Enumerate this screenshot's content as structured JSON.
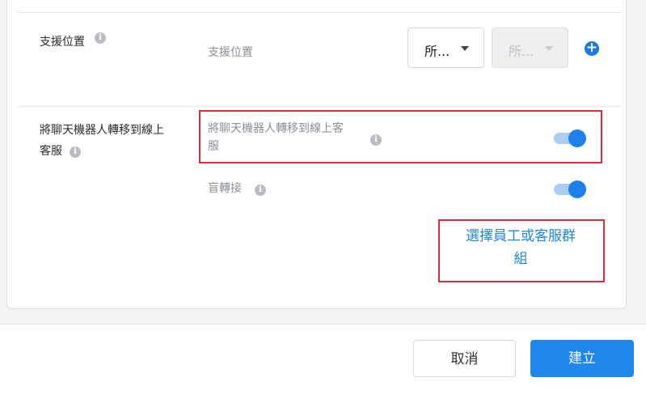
{
  "support_location": {
    "row_label": "支援位置",
    "field_label": "支援位置",
    "select_primary": "所...",
    "select_secondary": "所..."
  },
  "transfer": {
    "row_label_line1": "將聊天機器人轉移到線上",
    "row_label_line2": "客服",
    "field_label_line1": "將聊天機器人轉移到線上客",
    "field_label_line2": "服",
    "toggle_on": true
  },
  "blind_transfer": {
    "label": "盲轉接",
    "toggle_on": true
  },
  "select_agent": {
    "line1": "選擇員工或客服群",
    "line2": "組"
  },
  "footer": {
    "cancel": "取消",
    "create": "建立"
  },
  "icons": {
    "info": "info-icon",
    "add": "plus-circle-icon",
    "dropdown": "chevron-down-icon"
  },
  "colors": {
    "accent": "#1f86ee",
    "highlight": "#d32f3a"
  }
}
